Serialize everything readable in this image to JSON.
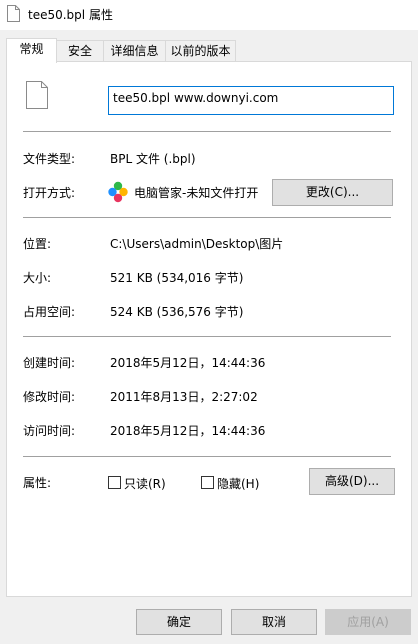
{
  "window": {
    "title": "tee50.bpl 属性"
  },
  "tabs": [
    {
      "label": "常规"
    },
    {
      "label": "安全"
    },
    {
      "label": "详细信息"
    },
    {
      "label": "以前的版本"
    }
  ],
  "general": {
    "file_name": "tee50.bpl www.downyi.com",
    "type_label": "文件类型:",
    "type_value": "BPL 文件 (.bpl)",
    "open_with_label": "打开方式:",
    "open_with_value": "电脑管家-未知文件打开",
    "change_button": "更改(C)...",
    "location_label": "位置:",
    "location_value": "C:\\Users\\admin\\Desktop\\图片",
    "size_label": "大小:",
    "size_value": "521 KB (534,016 字节)",
    "size_on_disk_label": "占用空间:",
    "size_on_disk_value": "524 KB (536,576 字节)",
    "created_label": "创建时间:",
    "created_value": "2018年5月12日，14:44:36",
    "modified_label": "修改时间:",
    "modified_value": "2011年8月13日，2:27:02",
    "accessed_label": "访问时间:",
    "accessed_value": "2018年5月12日，14:44:36",
    "attributes_label": "属性:",
    "readonly_label": "只读(R)",
    "hidden_label": "隐藏(H)",
    "advanced_button": "高级(D)..."
  },
  "footer": {
    "ok_button": "确定",
    "cancel_button": "取消",
    "apply_button": "应用(A)"
  },
  "colors": {
    "focus_border": "#0078d7",
    "panel_bg": "#ffffff",
    "window_bg": "#f0f0f0"
  }
}
